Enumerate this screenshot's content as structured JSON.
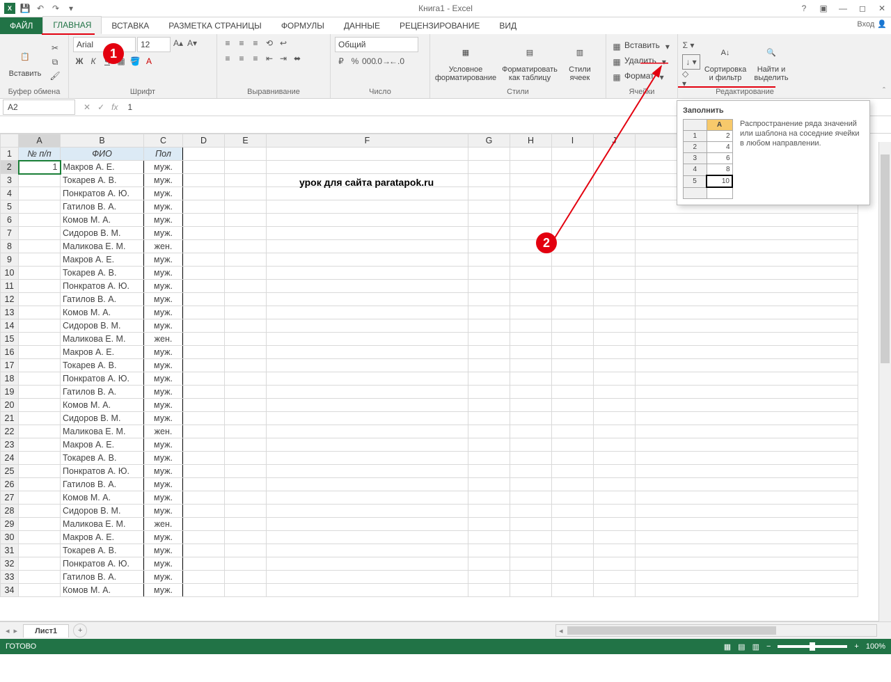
{
  "title": "Книга1 - Excel",
  "login": "Вход",
  "tabs": {
    "file": "ФАЙЛ",
    "items": [
      "ГЛАВНАЯ",
      "ВСТАВКА",
      "РАЗМЕТКА СТРАНИЦЫ",
      "ФОРМУЛЫ",
      "ДАННЫЕ",
      "РЕЦЕНЗИРОВАНИЕ",
      "ВИД"
    ],
    "active": 0
  },
  "ribbon": {
    "clipboard": {
      "paste": "Вставить",
      "label": "Буфер обмена"
    },
    "font": {
      "name": "Arial",
      "size": "12",
      "label": "Шрифт"
    },
    "align": {
      "label": "Выравнивание"
    },
    "number": {
      "format": "Общий",
      "label": "Число"
    },
    "styles": {
      "cond": "Условное\nформатирование",
      "table": "Форматировать\nкак таблицу",
      "cell": "Стили\nячеек",
      "label": "Стили"
    },
    "cells": {
      "insert": "Вставить",
      "delete": "Удалить",
      "format": "Формат",
      "label": "Ячейки"
    },
    "editing": {
      "sort": "Сортировка\nи фильтр",
      "find": "Найти и\nвыделить",
      "label": "Редактирование"
    }
  },
  "namebox": "A2",
  "formula": "1",
  "columns": [
    "A",
    "B",
    "C",
    "D",
    "E",
    "F",
    "G",
    "H",
    "I",
    "J"
  ],
  "headers": {
    "a": "№ п/п",
    "b": "ФИО",
    "c": "Пол"
  },
  "rows": [
    {
      "n": 1,
      "a": "",
      "b": "",
      "c": "",
      "hdr": true
    },
    {
      "n": 2,
      "a": "1",
      "b": "Макров А. Е.",
      "c": "муж."
    },
    {
      "n": 3,
      "a": "",
      "b": "Токарев А. В.",
      "c": "муж."
    },
    {
      "n": 4,
      "a": "",
      "b": "Понкратов А. Ю.",
      "c": "муж."
    },
    {
      "n": 5,
      "a": "",
      "b": "Гатилов В. А.",
      "c": "муж."
    },
    {
      "n": 6,
      "a": "",
      "b": "Комов М. А.",
      "c": "муж."
    },
    {
      "n": 7,
      "a": "",
      "b": "Сидоров В. М.",
      "c": "муж."
    },
    {
      "n": 8,
      "a": "",
      "b": "Маликова Е. М.",
      "c": "жен."
    },
    {
      "n": 9,
      "a": "",
      "b": "Макров А. Е.",
      "c": "муж."
    },
    {
      "n": 10,
      "a": "",
      "b": "Токарев А. В.",
      "c": "муж."
    },
    {
      "n": 11,
      "a": "",
      "b": "Понкратов А. Ю.",
      "c": "муж."
    },
    {
      "n": 12,
      "a": "",
      "b": "Гатилов В. А.",
      "c": "муж."
    },
    {
      "n": 13,
      "a": "",
      "b": "Комов М. А.",
      "c": "муж."
    },
    {
      "n": 14,
      "a": "",
      "b": "Сидоров В. М.",
      "c": "муж."
    },
    {
      "n": 15,
      "a": "",
      "b": "Маликова Е. М.",
      "c": "жен."
    },
    {
      "n": 16,
      "a": "",
      "b": "Макров А. Е.",
      "c": "муж."
    },
    {
      "n": 17,
      "a": "",
      "b": "Токарев А. В.",
      "c": "муж."
    },
    {
      "n": 18,
      "a": "",
      "b": "Понкратов А. Ю.",
      "c": "муж."
    },
    {
      "n": 19,
      "a": "",
      "b": "Гатилов В. А.",
      "c": "муж."
    },
    {
      "n": 20,
      "a": "",
      "b": "Комов М. А.",
      "c": "муж."
    },
    {
      "n": 21,
      "a": "",
      "b": "Сидоров В. М.",
      "c": "муж."
    },
    {
      "n": 22,
      "a": "",
      "b": "Маликова Е. М.",
      "c": "жен."
    },
    {
      "n": 23,
      "a": "",
      "b": "Макров А. Е.",
      "c": "муж."
    },
    {
      "n": 24,
      "a": "",
      "b": "Токарев А. В.",
      "c": "муж."
    },
    {
      "n": 25,
      "a": "",
      "b": "Понкратов А. Ю.",
      "c": "муж."
    },
    {
      "n": 26,
      "a": "",
      "b": "Гатилов В. А.",
      "c": "муж."
    },
    {
      "n": 27,
      "a": "",
      "b": "Комов М. А.",
      "c": "муж."
    },
    {
      "n": 28,
      "a": "",
      "b": "Сидоров В. М.",
      "c": "муж."
    },
    {
      "n": 29,
      "a": "",
      "b": "Маликова Е. М.",
      "c": "жен."
    },
    {
      "n": 30,
      "a": "",
      "b": "Макров А. Е.",
      "c": "муж."
    },
    {
      "n": 31,
      "a": "",
      "b": "Токарев А. В.",
      "c": "муж."
    },
    {
      "n": 32,
      "a": "",
      "b": "Понкратов А. Ю.",
      "c": "муж."
    },
    {
      "n": 33,
      "a": "",
      "b": "Гатилов В. А.",
      "c": "муж."
    },
    {
      "n": 34,
      "a": "",
      "b": "Комов М. А.",
      "c": "муж."
    }
  ],
  "watermark": "урок для сайта paratapok.ru",
  "sheet": "Лист1",
  "status": {
    "ready": "ГОТОВО",
    "zoom": "100%"
  },
  "tooltip": {
    "title": "Заполнить",
    "desc": "Распространение ряда значений или шаблона на соседние ячейки в любом направлении.",
    "mini": {
      "col": "A",
      "rows": [
        [
          1,
          2
        ],
        [
          2,
          4
        ],
        [
          3,
          6
        ],
        [
          4,
          8
        ],
        [
          5,
          10
        ]
      ]
    }
  },
  "callouts": {
    "c1": "1",
    "c2": "2"
  }
}
